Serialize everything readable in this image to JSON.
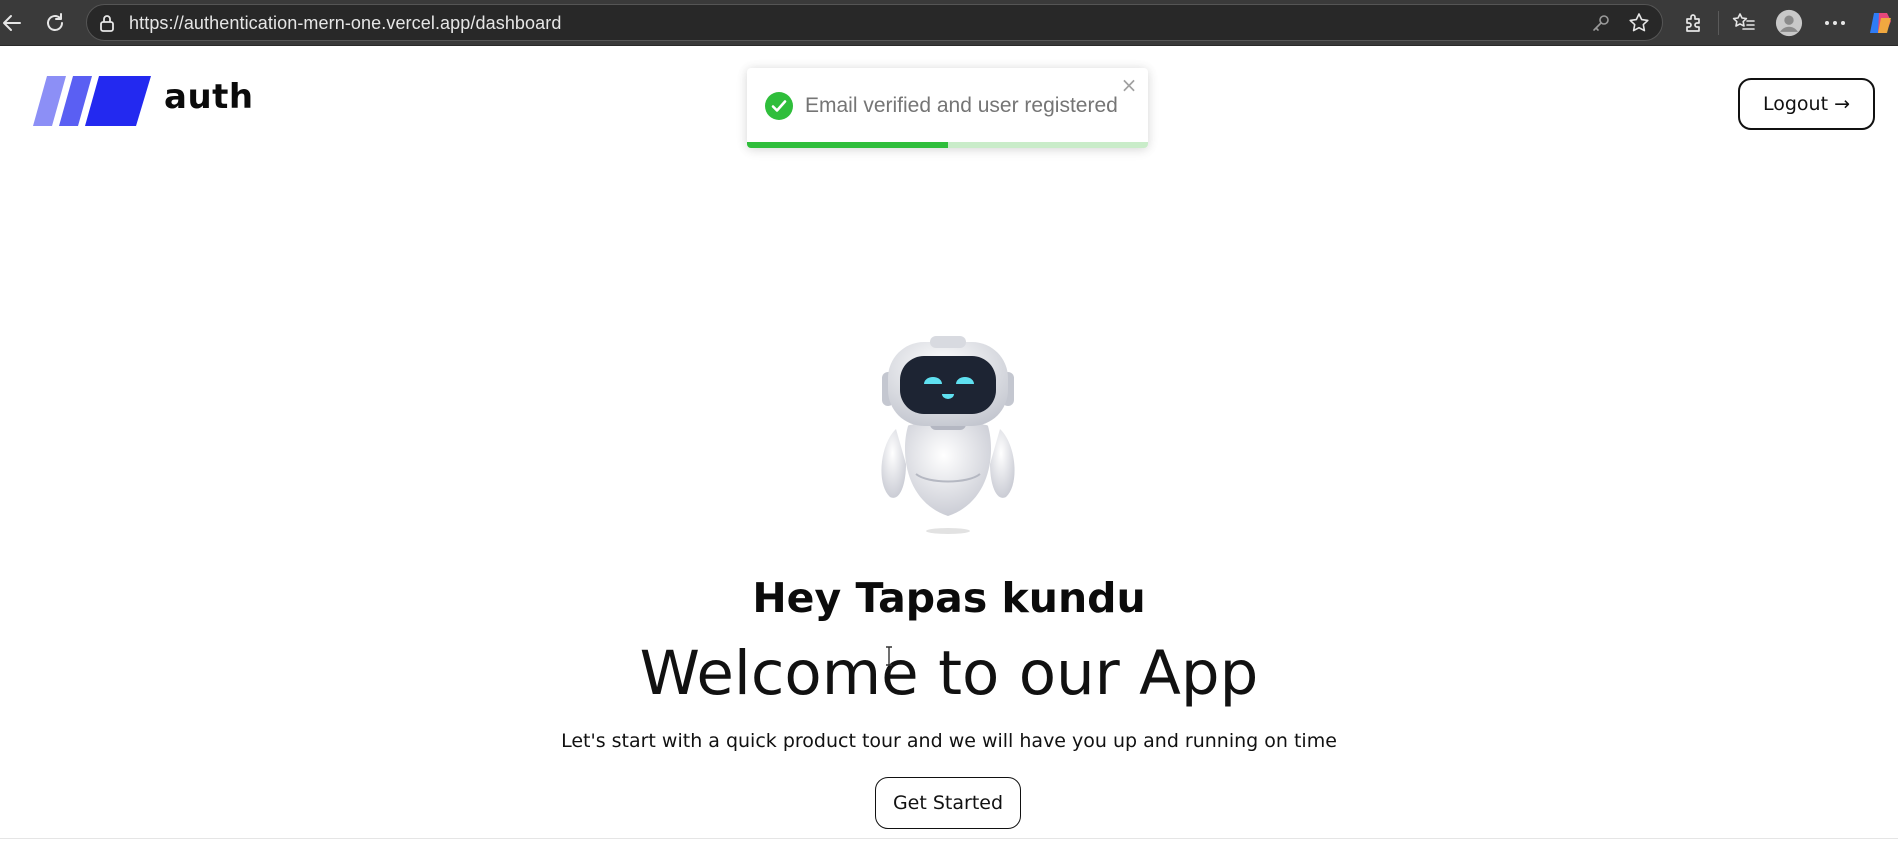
{
  "browser": {
    "url": "https://authentication-mern-one.vercel.app/dashboard"
  },
  "header": {
    "brand": "auth",
    "logout_label": "Logout",
    "logout_arrow": "→"
  },
  "toast": {
    "message": "Email verified and user registered",
    "close_glyph": "×",
    "progress": 0.5,
    "status_color": "#2fbe3b"
  },
  "main": {
    "greeting": "Hey Tapas kundu",
    "headline": "Welcome to our App",
    "subline": "Let's start with a quick product tour and we will have you up and running on time",
    "cta_label": "Get Started"
  },
  "colors": {
    "brand_blue": "#2329f0",
    "brand_mid": "#5a5ff3",
    "brand_light": "#8c8ff6",
    "robot_eyes": "#5fe0f0"
  },
  "icons": {
    "back": "back-arrow-icon",
    "reload": "reload-icon",
    "lock": "lock-icon",
    "key": "key-icon",
    "favorite": "star-icon",
    "extensions": "puzzle-icon",
    "favorites": "favorites-list-icon",
    "profile": "profile-icon",
    "more": "more-icon",
    "copilot": "copilot-icon",
    "success": "check-circle-icon"
  }
}
